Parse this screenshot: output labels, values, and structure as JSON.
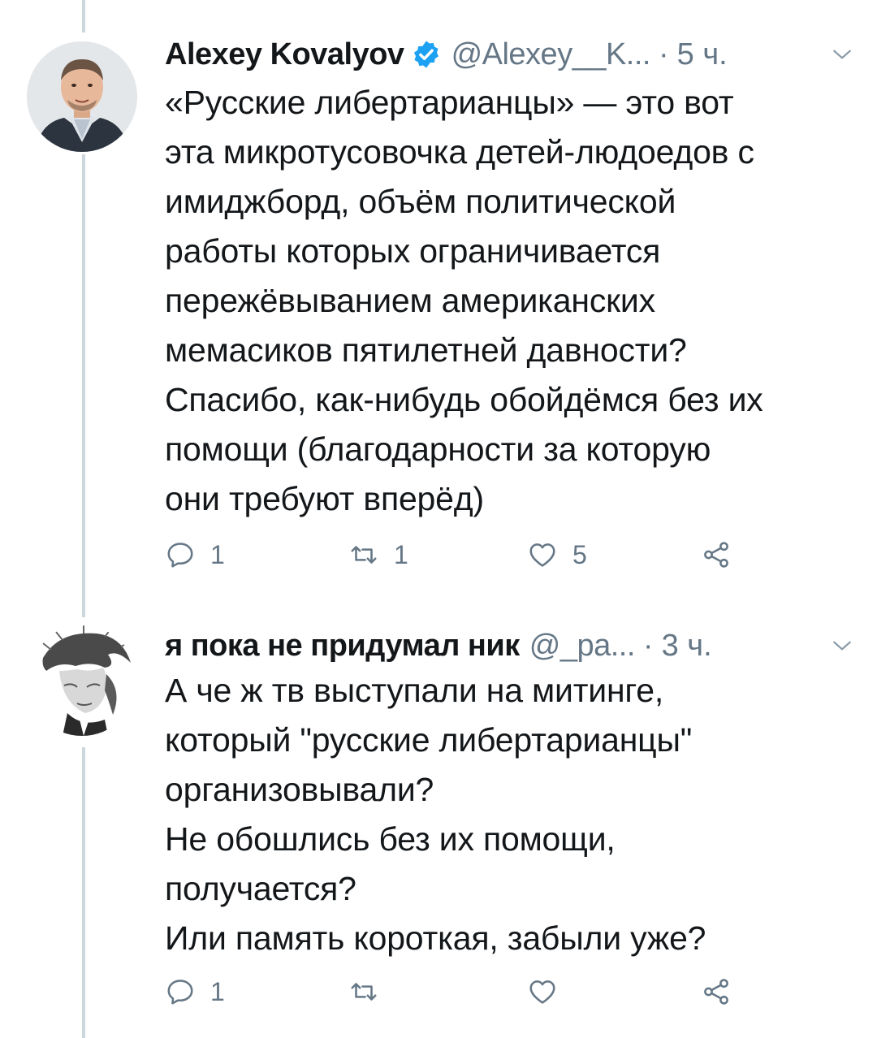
{
  "tweets": [
    {
      "author": {
        "name": "Alexey Kovalyov",
        "handle": "@Alexey__K...",
        "verified": true,
        "avatar": "person-photo"
      },
      "separator": "·",
      "time": "5 ч.",
      "text": "«Русские либертарианцы» — это вот\nэта микротусовочка детей-людоедов с\nимиджборд, объём политической\nработы которых ограничивается\nпережёвыванием американских\nмемасиков пятилетней давности?\nСпасибо, как-нибудь обойдёмся без их\nпомощи (благодарности за которую\nони требуют вперёд)",
      "stats": {
        "replies": "1",
        "retweets": "1",
        "likes": "5"
      }
    },
    {
      "author": {
        "name": "я пока не придумал ник",
        "handle": "@_pa...",
        "verified": false,
        "avatar": "sketch-portrait"
      },
      "separator": "·",
      "time": "3 ч.",
      "text": "А че ж тв выступали на митинге,\nкоторый \"русские либертарианцы\"\nорганизовывали?\nНе обошлись без их помощи,\nполучается?\nИли память короткая, забыли уже?",
      "stats": {
        "replies": "1",
        "retweets": "",
        "likes": ""
      }
    }
  ],
  "icons": {
    "reply": "reply-icon",
    "retweet": "retweet-icon",
    "like": "heart-icon",
    "share": "share-icon",
    "more": "chevron-down-icon",
    "verified": "verified-badge-icon"
  },
  "colors": {
    "text": "#14171a",
    "secondary": "#657786",
    "verified": "#1da1f2",
    "thread_line": "#ccd6dd"
  }
}
